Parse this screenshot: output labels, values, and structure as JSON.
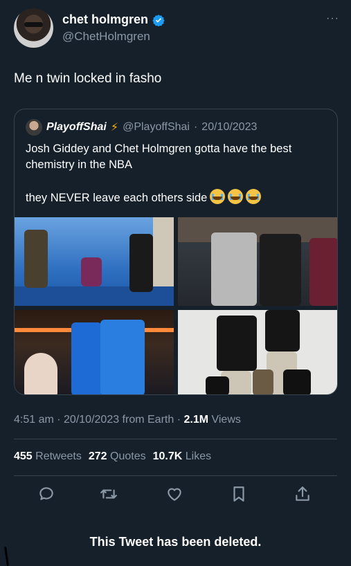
{
  "tweet": {
    "author": {
      "display_name": "chet holmgren",
      "handle": "@ChetHolmgren",
      "verified": true
    },
    "text": "Me n twin locked in fasho",
    "quoted": {
      "author": {
        "display_name": "PlayoffShai",
        "badge": "⚡",
        "handle": "@PlayoffShai",
        "date": "20/10/2023"
      },
      "text_line1": "Josh Giddey and Chet Holmgren gotta have the best chemistry in the NBA",
      "text_line2": "they NEVER leave each others side"
    },
    "meta": {
      "time_date_source": "4:51 am · 20/10/2023 from Earth · ",
      "views_count": "2.1M",
      "views_label": " Views"
    },
    "stats": {
      "retweets_count": "455",
      "retweets_label": "Retweets",
      "quotes_count": "272",
      "quotes_label": "Quotes",
      "likes_count": "10.7K",
      "likes_label": "Likes"
    },
    "more_label": "···"
  },
  "footer": {
    "deleted_notice": "This Tweet has been deleted."
  },
  "icons": [
    "verified-badge-icon",
    "more-icon",
    "reply-icon",
    "retweet-icon",
    "like-icon",
    "bookmark-icon",
    "share-icon",
    "crying-emoji-icon"
  ],
  "colors": {
    "background": "#15202b",
    "text": "#ffffff",
    "muted": "#8b98a5",
    "border": "#38444d",
    "verified": "#1d9bf0"
  }
}
